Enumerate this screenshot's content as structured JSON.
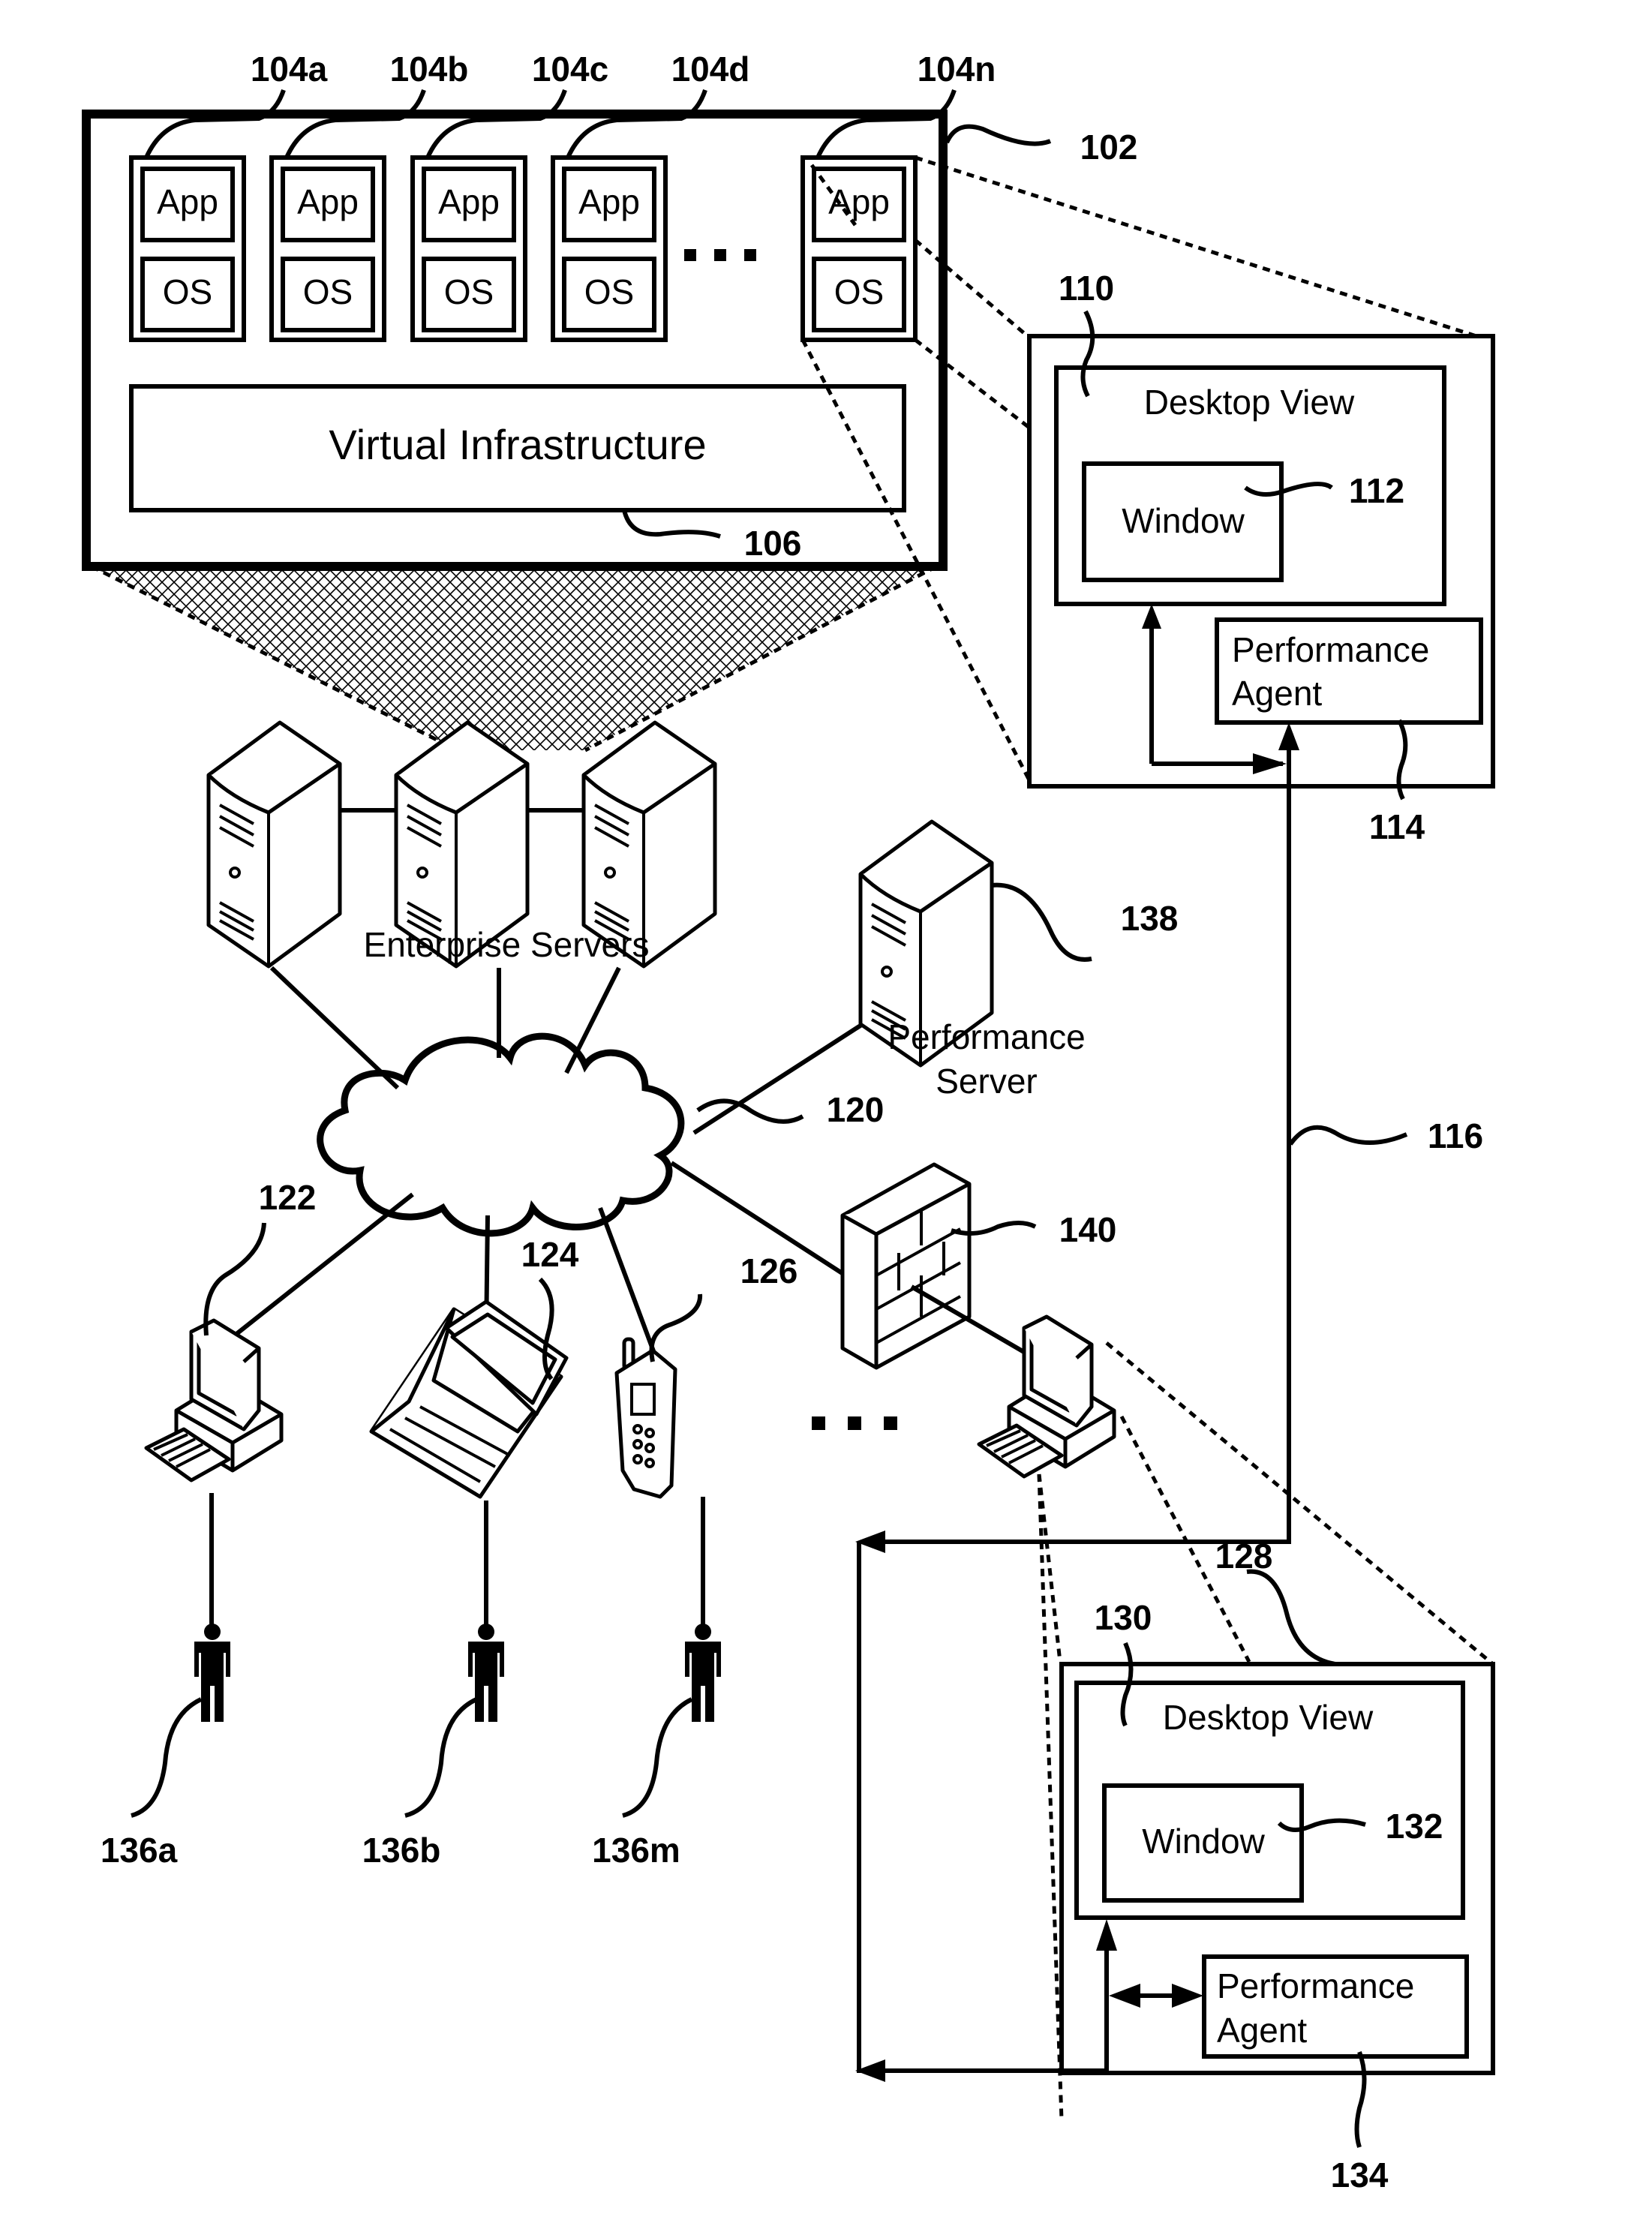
{
  "figure": {
    "labels": {
      "vm_a": "104a",
      "vm_b": "104b",
      "vm_c": "104c",
      "vm_d": "104d",
      "vm_n": "104n",
      "host": "102",
      "virtual_infra": "106",
      "desktop_view_top": "110",
      "window_top": "112",
      "perf_agent_top": "114",
      "link_116": "116",
      "network": "120",
      "client_desktop": "122",
      "client_laptop": "124",
      "client_phone": "126",
      "client_system": "128",
      "desktop_view_bottom": "130",
      "window_bottom": "132",
      "perf_agent_bottom": "134",
      "user_a": "136a",
      "user_b": "136b",
      "user_m": "136m",
      "perf_server": "138",
      "firewall": "140"
    },
    "vm": {
      "app": "App",
      "os": "OS"
    },
    "virtual_infrastructure": "Virtual Infrastructure",
    "ellipsis": "▪ ▪ ▪",
    "enterprise_servers": "Enterprise Servers",
    "performance_server": [
      "Performance",
      "Server"
    ],
    "desktop_view": "Desktop View",
    "window": "Window",
    "performance_agent": [
      "Performance",
      "Agent"
    ]
  }
}
